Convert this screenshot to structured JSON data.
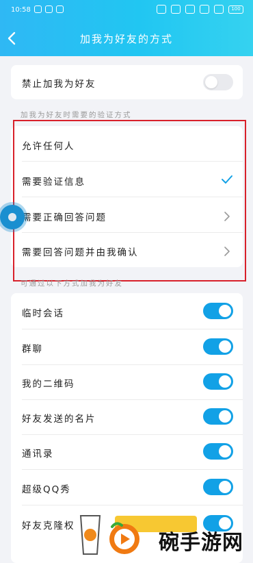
{
  "status_bar": {
    "time": "10:58",
    "battery": "100"
  },
  "header": {
    "title": "加我为好友的方式"
  },
  "block_section": {
    "label": "禁止加我为好友",
    "toggle_on": false
  },
  "verify_section": {
    "header": "加我为好友时需要的验证方式",
    "options": [
      {
        "label": "允许任何人",
        "indicator": "none"
      },
      {
        "label": "需要验证信息",
        "indicator": "check-icon"
      },
      {
        "label": "需要正确回答问题",
        "indicator": "chevron-right-icon"
      },
      {
        "label": "需要回答问题并由我确认",
        "indicator": "chevron-right-icon"
      }
    ]
  },
  "sources_section": {
    "header": "可通过以下方式加我为好友",
    "items": [
      {
        "label": "临时会话",
        "toggle_on": true
      },
      {
        "label": "群聊",
        "toggle_on": true
      },
      {
        "label": "我的二维码",
        "toggle_on": true
      },
      {
        "label": "好友发送的名片",
        "toggle_on": true
      },
      {
        "label": "通讯录",
        "toggle_on": true
      },
      {
        "label": "超级QQ秀",
        "toggle_on": true
      },
      {
        "label": "好友克隆权",
        "toggle_on": true
      }
    ]
  },
  "watermark": {
    "text": "碗手游网"
  },
  "colors": {
    "header_gradient_start": "#2fb8f4",
    "toggle_on": "#12a1e6",
    "check": "#12a1e6",
    "highlight_box": "#d8202a"
  }
}
